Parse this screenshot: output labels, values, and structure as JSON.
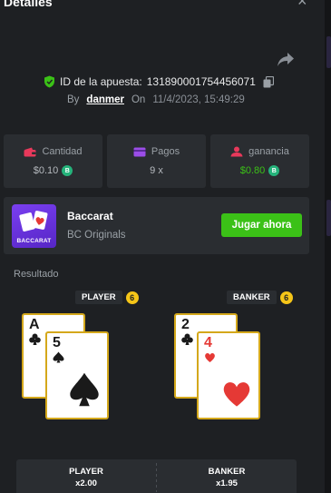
{
  "header": {
    "title": "Detalles",
    "close_glyph": "×"
  },
  "bet": {
    "id_label": "ID de la apuesta:",
    "id_value": "131890001754456071",
    "by_label": "By",
    "user": "danmer",
    "on_label": "On",
    "date": "11/4/2023, 15:49:29"
  },
  "stats": [
    {
      "icon": "wallet-icon",
      "label": "Cantidad",
      "value": "$0.10"
    },
    {
      "icon": "card-icon",
      "label": "Pagos",
      "value": "9 x"
    },
    {
      "icon": "profit-icon",
      "label": "ganancia",
      "value": "$0.80"
    }
  ],
  "game": {
    "name": "Baccarat",
    "provider": "BC Originals",
    "thumb_label": "BACCARAT",
    "play_label": "Jugar ahora"
  },
  "results": {
    "title": "Resultado",
    "player": {
      "label": "PLAYER",
      "score": "6",
      "cards": [
        {
          "rank": "A",
          "suit": "clubs"
        },
        {
          "rank": "5",
          "suit": "spades"
        }
      ]
    },
    "banker": {
      "label": "BANKER",
      "score": "6",
      "cards": [
        {
          "rank": "2",
          "suit": "clubs"
        },
        {
          "rank": "4",
          "suit": "hearts"
        }
      ]
    }
  },
  "odds": [
    {
      "label": "PLAYER",
      "multiplier": "x2.00"
    },
    {
      "label": "BANKER",
      "multiplier": "x1.95"
    }
  ],
  "colors": {
    "accent_green": "#3bc117",
    "coin": "#25b37b",
    "badge_gold": "#f5c518",
    "card_border": "#d4a81b",
    "panel": "#2a2d31",
    "background": "#1e2023"
  }
}
